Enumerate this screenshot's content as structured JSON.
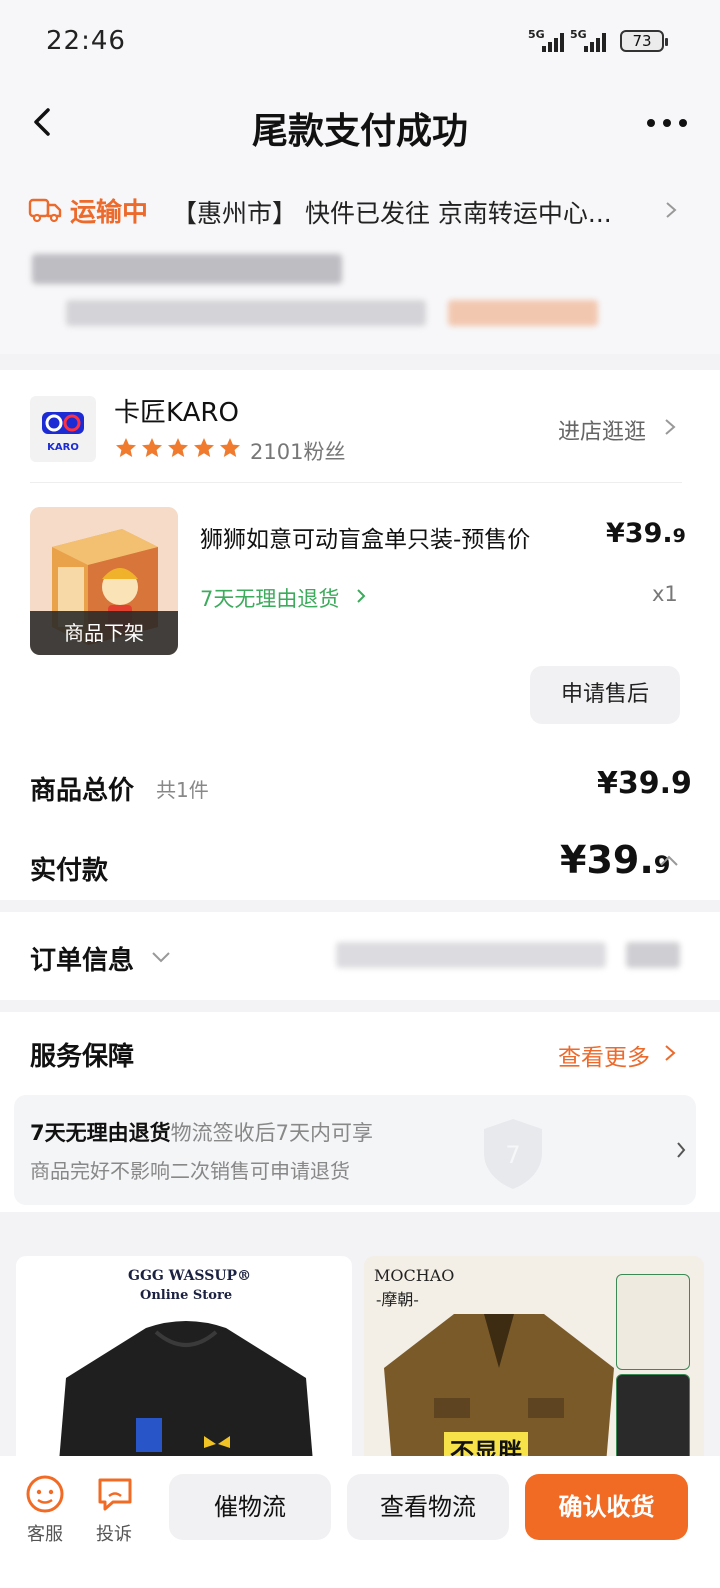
{
  "status_bar": {
    "time": "22:46",
    "signal_label": "5G",
    "battery": "73"
  },
  "header": {
    "title": "尾款支付成功"
  },
  "logistics": {
    "state": "运输中",
    "detail": "【惠州市】 快件已发往 京南转运中心..."
  },
  "shop": {
    "name": "卡匠KARO",
    "logo_text": "KARO",
    "fans": "2101粉丝",
    "enter": "进店逛逛",
    "rating_stars": 5
  },
  "product": {
    "title": "狮狮如意可动盲盒单只装-预售价",
    "price_main": "¥39.",
    "price_dec": "9",
    "return_policy": "7天无理由退货",
    "qty": "x1",
    "status_overlay": "商品下架",
    "after_sale_button": "申请售后"
  },
  "summary": {
    "total_label": "商品总价",
    "total_count": "共1件",
    "total_value": "¥39.9",
    "paid_label": "实付款",
    "paid_main": "¥39.",
    "paid_dec": "9"
  },
  "order_info": {
    "label": "订单信息"
  },
  "service": {
    "title": "服务保障",
    "more": "查看更多",
    "item_title": "7天无理由退货",
    "item_note": "物流签收后7天内可享",
    "item_desc": "商品完好不影响二次销售可申请退货"
  },
  "recommendations": [
    {
      "brand": "GGG WASSUP®",
      "sub": "Online Store"
    },
    {
      "brand": "MOCHAO",
      "sub": "-摩朝-",
      "caption": "不显胖"
    }
  ],
  "bottom_bar": {
    "service_label": "客服",
    "complain_label": "投诉",
    "urge_button": "催物流",
    "view_logistics_button": "查看物流",
    "confirm_button": "确认收货"
  },
  "colors": {
    "accent": "#f26b25",
    "green": "#3dab5c",
    "star": "#f07a2e"
  }
}
